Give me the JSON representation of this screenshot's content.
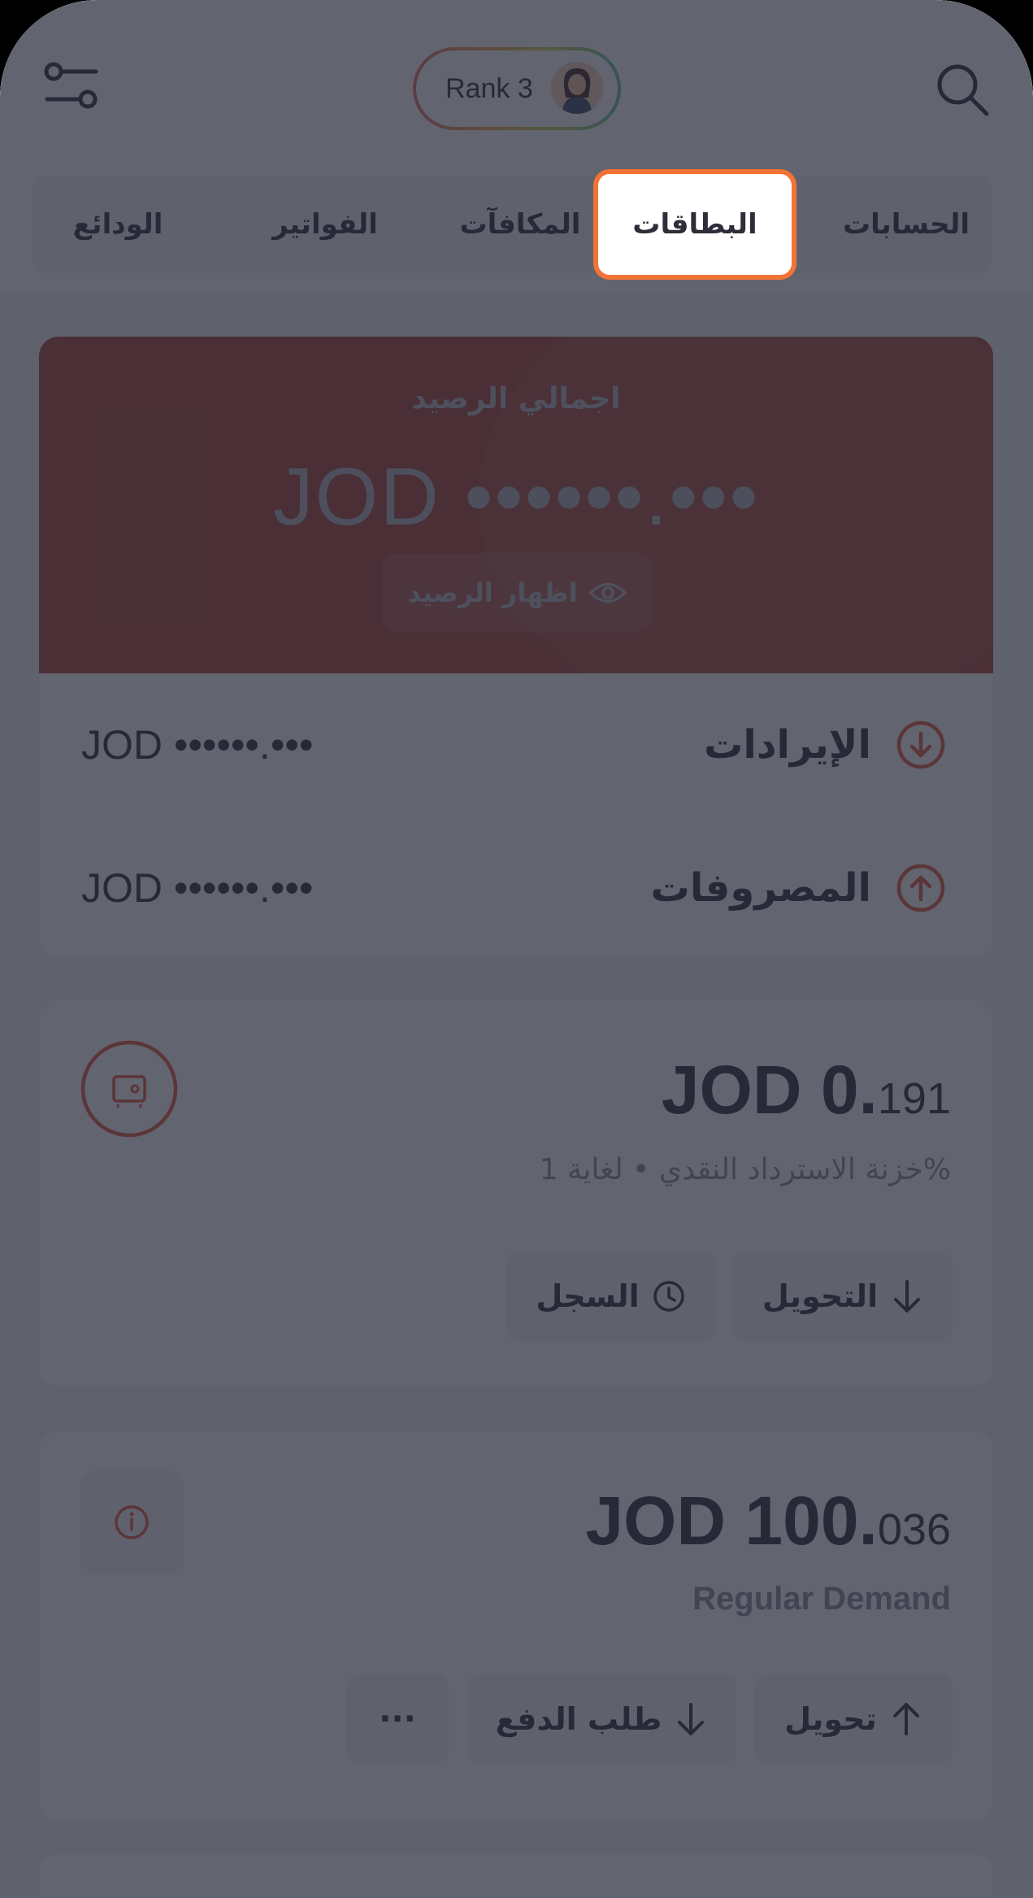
{
  "header": {
    "rank_label": "Rank 3"
  },
  "tabs": [
    {
      "label": "الحسابات"
    },
    {
      "label": "البطاقات",
      "active": true
    },
    {
      "label": "المكافآت"
    },
    {
      "label": "الفواتير"
    },
    {
      "label": "الودائع"
    }
  ],
  "balance": {
    "title": "اجمالي الرصيد",
    "amount": "JOD ••••••.•••",
    "show_label": "اظهار الرصيد"
  },
  "summary": {
    "income_label": "الإيرادات",
    "income_value": "JOD ••••••.•••",
    "expense_label": "المصروفات",
    "expense_value": "JOD ••••••.•••"
  },
  "cashback": {
    "amount_main": "JOD 0.",
    "amount_fraction": "191",
    "subtitle": "خزنة الاسترداد النقدي • لغاية 1%",
    "transfer_label": "التحويل",
    "history_label": "السجل"
  },
  "account": {
    "amount_main": "JOD 100.",
    "amount_fraction": "036",
    "subtitle": "Regular Demand",
    "transfer_label": "تحويل",
    "request_label": "طلب الدفع",
    "more_label": "···"
  },
  "colors": {
    "accent": "#F27335",
    "hero": "#A84334",
    "overlay": "rgba(38,40,56,0.72)"
  }
}
